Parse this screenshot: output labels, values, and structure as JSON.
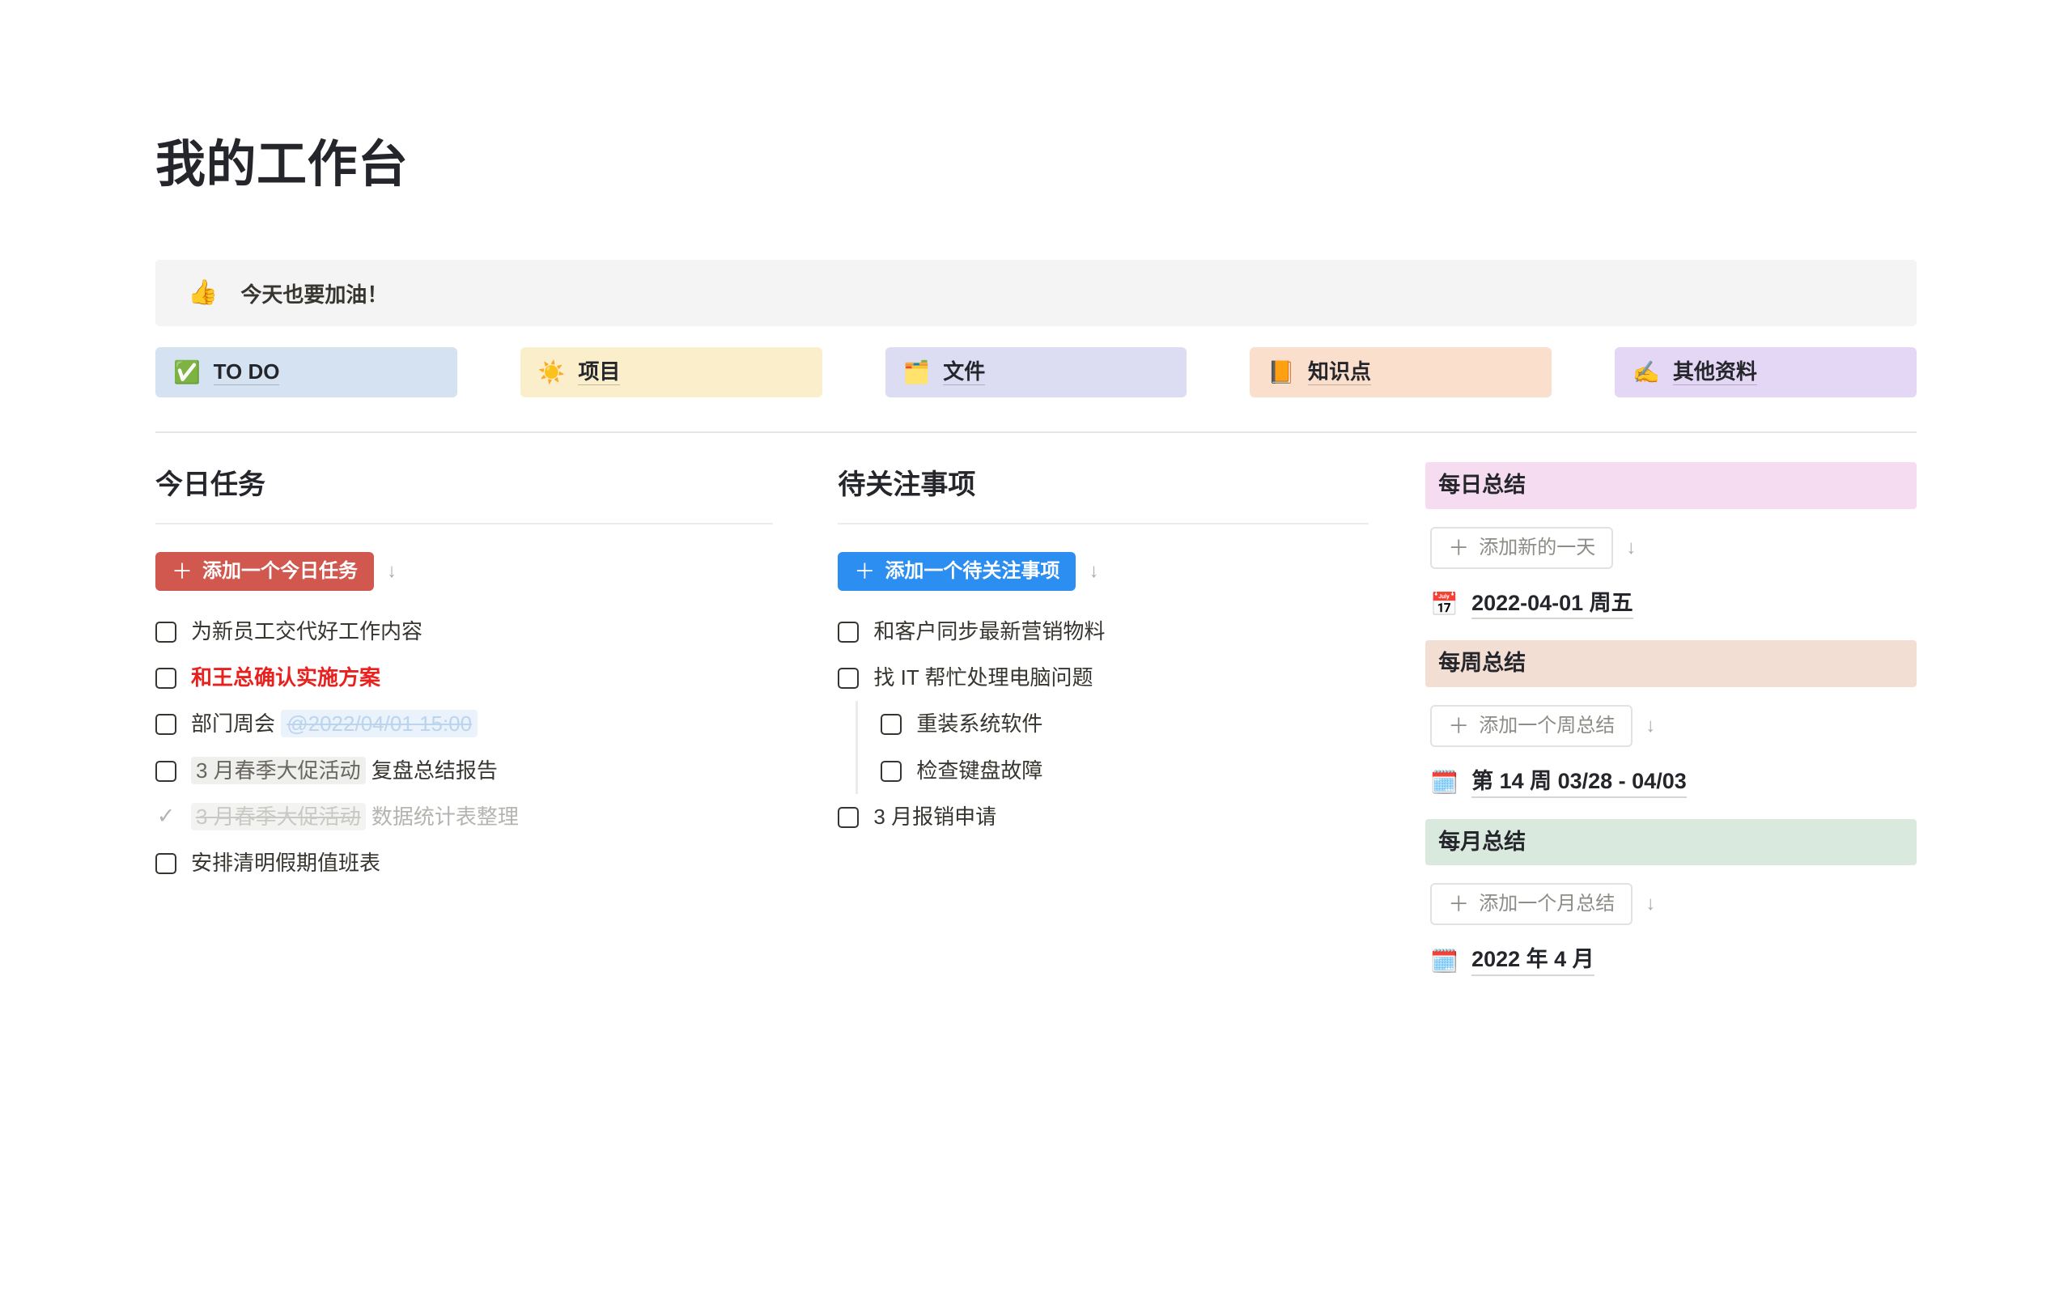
{
  "page": {
    "title": "我的工作台"
  },
  "callout": {
    "emoji": "👍",
    "emoji_name": "thumbs-up",
    "text": "今天也要加油！"
  },
  "chips": [
    {
      "emoji": "✅",
      "emoji_name": "check-mark-button-icon",
      "label": "TO DO",
      "bg": "#d4e2f2"
    },
    {
      "emoji": "☀️",
      "emoji_name": "sun-icon",
      "label": "项目",
      "bg": "#fbeecb"
    },
    {
      "emoji": "🗂️",
      "emoji_name": "card-index-dividers-icon",
      "label": "文件",
      "bg": "#dcdcf2"
    },
    {
      "emoji": "📙",
      "emoji_name": "orange-book-icon",
      "label": "知识点",
      "bg": "#fbdfcd"
    },
    {
      "emoji": "✍️",
      "emoji_name": "writing-hand-icon",
      "label": "其他资料",
      "bg": "#e4d7f5"
    }
  ],
  "tasks": {
    "heading": "今日任务",
    "add_label": "添加一个今日任务",
    "add_plus": "＋",
    "arrow": "↓",
    "items": [
      {
        "checked": false,
        "style": "normal",
        "parts": [
          {
            "type": "plain",
            "text": "为新员工交代好工作内容"
          }
        ]
      },
      {
        "checked": false,
        "style": "urgent",
        "parts": [
          {
            "type": "plain",
            "text": "和王总确认实施方案"
          }
        ]
      },
      {
        "checked": false,
        "style": "normal",
        "parts": [
          {
            "type": "plain",
            "text": "部门周会 "
          },
          {
            "type": "date",
            "text": "@2022/04/01 15:00"
          }
        ]
      },
      {
        "checked": false,
        "style": "normal",
        "parts": [
          {
            "type": "tag",
            "text": "3 月春季大促活动"
          },
          {
            "type": "plain",
            "text": " 复盘总结报告"
          }
        ]
      },
      {
        "checked": true,
        "style": "done",
        "parts": [
          {
            "type": "tag",
            "text": "3 月春季大促活动"
          },
          {
            "type": "plain",
            "text": " 数据统计表整理"
          }
        ]
      },
      {
        "checked": false,
        "style": "normal",
        "parts": [
          {
            "type": "plain",
            "text": "安排清明假期值班表"
          }
        ]
      }
    ]
  },
  "watch": {
    "heading": "待关注事项",
    "add_label": "添加一个待关注事项",
    "add_plus": "＋",
    "arrow": "↓",
    "items": [
      {
        "checked": false,
        "text": "和客户同步最新营销物料",
        "children": []
      },
      {
        "checked": false,
        "text": "找 IT 帮忙处理电脑问题",
        "children": [
          {
            "checked": false,
            "text": "重装系统软件"
          },
          {
            "checked": false,
            "text": "检查键盘故障"
          }
        ]
      },
      {
        "checked": false,
        "text": "3 月报销申请",
        "children": []
      }
    ]
  },
  "summaries": [
    {
      "title": "每日总结",
      "color": "pink",
      "add_label": "添加新的一天",
      "add_plus": "＋",
      "arrow": "↓",
      "entry_icon": "📅",
      "entry_icon_name": "calendar-icon",
      "entry_label": "2022-04-01 周五"
    },
    {
      "title": "每周总结",
      "color": "peach",
      "add_label": "添加一个周总结",
      "add_plus": "＋",
      "arrow": "↓",
      "entry_icon": "🗓️",
      "entry_icon_name": "spiral-calendar-icon",
      "entry_label": "第 14 周 03/28 - 04/03"
    },
    {
      "title": "每月总结",
      "color": "mint",
      "add_label": "添加一个月总结",
      "add_plus": "＋",
      "arrow": "↓",
      "entry_icon": "🗓️",
      "entry_icon_name": "spiral-calendar-icon",
      "entry_label": "2022 年 4 月"
    }
  ]
}
